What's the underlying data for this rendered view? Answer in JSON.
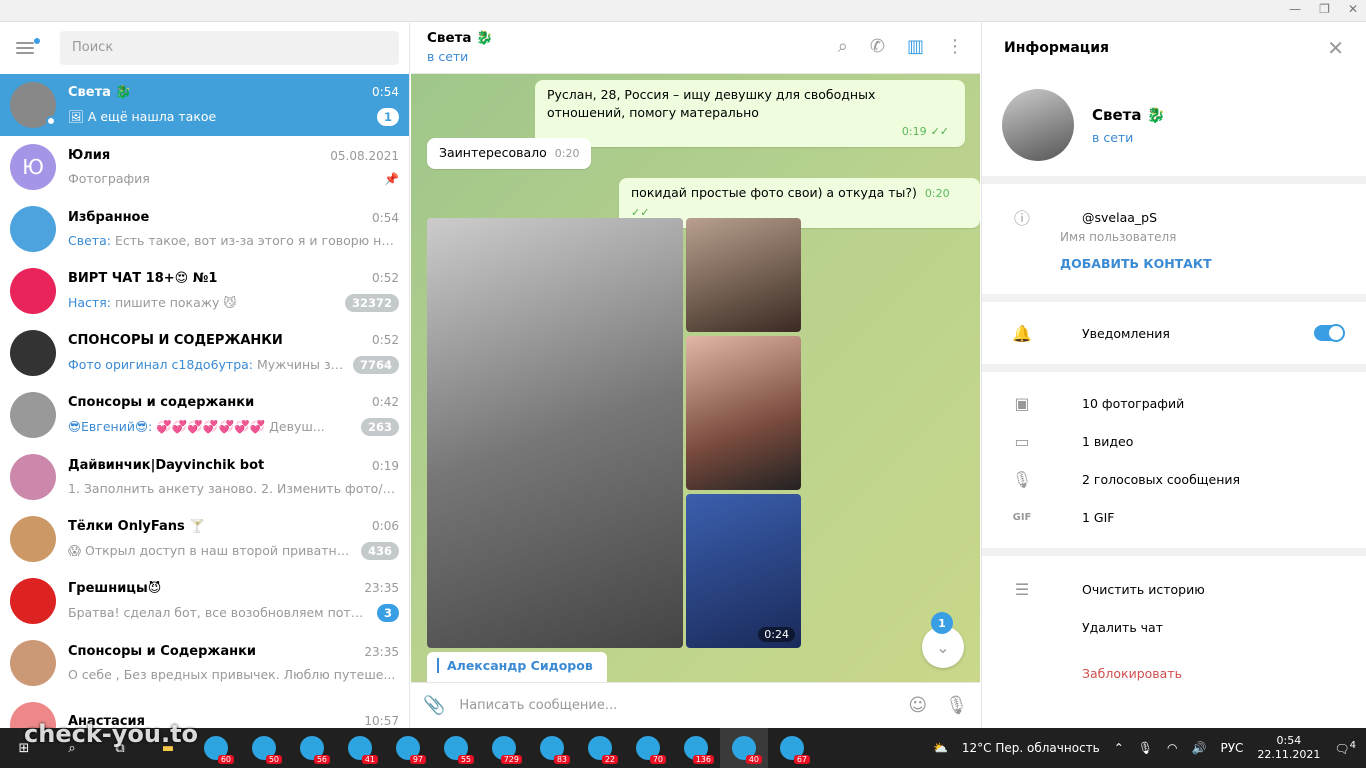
{
  "search_placeholder": "Поиск",
  "chats": [
    {
      "name": "Света 🐉",
      "time": "0:54",
      "prefix": "",
      "msg": "🖼 А ещё нашла такое",
      "badge": "1",
      "active": true,
      "color": "#888"
    },
    {
      "name": "Юлия",
      "time": "05.08.2021",
      "prefix": "",
      "msg": "Фотография",
      "badge": "",
      "pinned": true,
      "letter": "Ю",
      "color": "#a695e7"
    },
    {
      "name": "Избранное",
      "time": "0:54",
      "prefix": "Света:",
      "msg": "Есть такое, вот из-за этого я и говорю не ...",
      "badge": "",
      "color": "#4ca3dd"
    },
    {
      "name": "ВИРТ ЧАТ 18+😍 №1",
      "time": "0:52",
      "prefix": "Настя:",
      "msg": "пишите покажу 😼",
      "badge": "32372",
      "color": "#e8245b"
    },
    {
      "name": "СПОНСОРЫ И СОДЕРЖАНКИ",
      "time": "0:52",
      "prefix": "Фото оригинал с18до6утра:",
      "msg": "Мужчины здрав...",
      "badge": "7764",
      "color": "#333"
    },
    {
      "name": "Спонсоры и содержанки",
      "time": "0:42",
      "prefix": "😎Евгений😎:",
      "msg": "💞💞💞💞💞💞💞 Девуш...",
      "badge": "263",
      "color": "#999"
    },
    {
      "name": "Дайвинчик|Dayvinchik bot",
      "time": "0:19",
      "prefix": "",
      "msg": "1. Заполнить анкету заново. 2. Изменить фото/виде...",
      "badge": "",
      "color": "#c8a"
    },
    {
      "name": "Тёлки OnlyFans 🍸",
      "time": "0:06",
      "prefix": "",
      "msg": "😱 Открыл доступ в наш второй приватный к...",
      "badge": "436",
      "color": "#c96"
    },
    {
      "name": "Грешницы😈",
      "time": "23:35",
      "prefix": "",
      "msg": "Братва! сделал бот, все возобновляем потихонь...",
      "badge": "3",
      "badgeBlue": true,
      "color": "#d22"
    },
    {
      "name": "Спонсоры и Содержанки",
      "time": "23:35",
      "prefix": "",
      "msg": "О себе ,  Без вредных привычек.  Люблю путеше...",
      "badge": "",
      "color": "#c97"
    },
    {
      "name": "Анастасия",
      "time": "10:57",
      "prefix": "",
      "msg": "",
      "badge": "",
      "color": "#e88"
    }
  ],
  "header": {
    "name": "Света 🐉",
    "status": "в сети"
  },
  "messages": {
    "m1": "Руслан, 28, Россия – ищу девушку для свободных отношений, помогу матерально",
    "m1_time": "0:19",
    "m2": "Заинтересовало",
    "m2_time": "0:20",
    "m3": "покидай простые фото свои) а откуда ты?)",
    "m3_time": "0:20",
    "video_duration": "0:24",
    "reply_name": "Александр Сидоров"
  },
  "scroll_badge": "1",
  "compose_placeholder": "Написать сообщение...",
  "info": {
    "title": "Информация",
    "name": "Света 🐉",
    "status": "в сети",
    "username": "@svelaa_pS",
    "username_label": "Имя пользователя",
    "add_contact": "ДОБАВИТЬ КОНТАКТ",
    "notifications": "Уведомления",
    "photos": "10 фотографий",
    "videos": "1 видео",
    "voice": "2 голосовых сообщения",
    "gif": "1 GIF",
    "clear": "Очистить историю",
    "delete": "Удалить чат",
    "block": "Заблокировать"
  },
  "taskbar": {
    "weather": "12°C  Пер. облачность",
    "lang": "РУС",
    "time": "0:54",
    "date": "22.11.2021",
    "notif": "4",
    "tg_badges": [
      "60",
      "50",
      "56",
      "41",
      "97",
      "55",
      "729",
      "83",
      "22",
      "70",
      "136",
      "40",
      "67"
    ]
  },
  "watermark": "check-you.to"
}
